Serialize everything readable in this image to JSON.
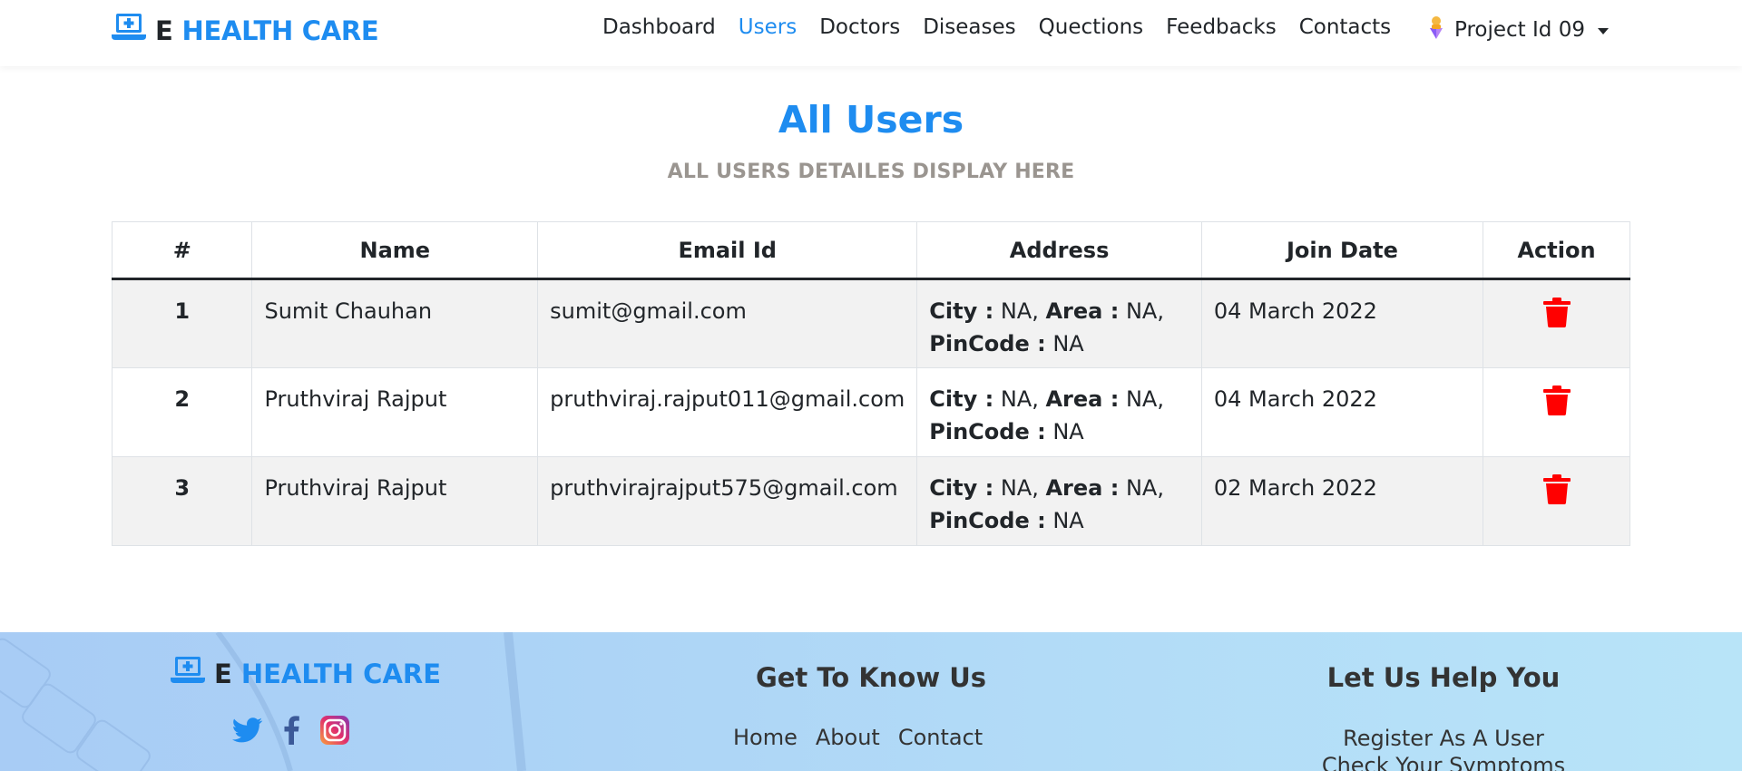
{
  "navbar": {
    "brand_e": "E",
    "brand_name": "HEALTH CARE",
    "links": [
      "Dashboard",
      "Users",
      "Doctors",
      "Diseases",
      "Quections",
      "Feedbacks",
      "Contacts"
    ],
    "active": "Users",
    "user_label": "Project Id 09"
  },
  "header": {
    "title": "All Users",
    "subtitle": "ALL USERS DETAILES DISPLAY HERE"
  },
  "table": {
    "columns": [
      "#",
      "Name",
      "Email Id",
      "Address",
      "Join Date",
      "Action"
    ],
    "address_labels": {
      "city": "City :",
      "area": "Area :",
      "pincode": "PinCode :"
    },
    "rows": [
      {
        "num": "1",
        "name": "Sumit Chauhan",
        "email": "sumit@gmail.com",
        "city": "NA",
        "area": "NA",
        "pincode": "NA",
        "join_date": "04 March 2022"
      },
      {
        "num": "2",
        "name": "Pruthviraj Rajput",
        "email": "pruthviraj.rajput011@gmail.com",
        "city": "NA",
        "area": "NA",
        "pincode": "NA",
        "join_date": "04 March 2022"
      },
      {
        "num": "3",
        "name": "Pruthviraj Rajput",
        "email": "pruthvirajrajput575@gmail.com",
        "city": "NA",
        "area": "NA",
        "pincode": "NA",
        "join_date": "02 March 2022"
      }
    ],
    "action_icon": "trash-icon"
  },
  "footer": {
    "brand_e": "E",
    "brand_name": "HEALTH CARE",
    "social": [
      "twitter-icon",
      "facebook-icon",
      "instagram-icon"
    ],
    "col2_title": "Get To Know Us",
    "col2_links": [
      "Home",
      "About",
      "Contact"
    ],
    "col3_title": "Let Us Help You",
    "col3_links": [
      "Register As A User",
      "Check Your Symptoms"
    ]
  },
  "colors": {
    "accent": "#1e8cf0",
    "delete": "#ff0000",
    "subtitle": "#9a9590",
    "row_stripe": "#f2f2f2"
  }
}
